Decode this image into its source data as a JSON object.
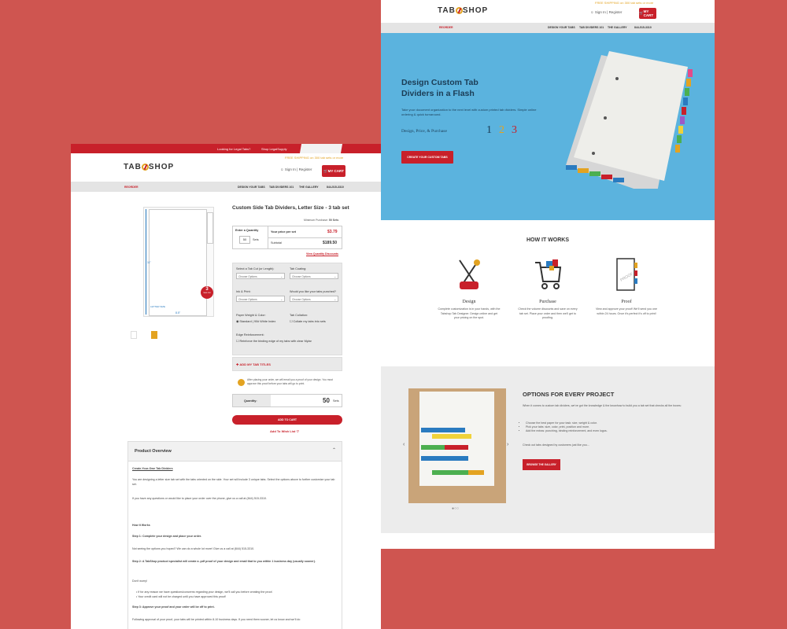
{
  "back": {
    "shipping_text": "FREE SHIPPING on 300 tab sets or more",
    "logo": "TAB SHOP",
    "sign_in": "Sign In",
    "register": "Register",
    "cart": "MY CART",
    "nav": {
      "reorder": "REORDER",
      "design": "DESIGN YOUR TABS",
      "dividers": "TAB DIVIDERS 101",
      "gallery": "THE GALLERY",
      "phone": "844-515-3310"
    },
    "hero": {
      "title": "Design Custom Tab Dividers in a Flash",
      "desc": "Take your document organization to the next level with custom printed tab dividers. Simple online ordering & quick turnaround.",
      "steps_label": "Design, Price, & Purchase",
      "n1": "1",
      "n2": "2",
      "n3": "3",
      "button": "CREATE YOUR CUSTOM TABS"
    },
    "how": {
      "title": "HOW IT WORKS",
      "steps": [
        {
          "title": "Design",
          "desc": "Complete customization is in your hands, with the Tabshop Tab Designer. Design online and get your pricing on the spot."
        },
        {
          "title": "Purchase",
          "desc": "Check the volume discounts and save on every tab set. Place your order and then we'll get to proofing."
        },
        {
          "title": "Proof",
          "desc": "View and approve your proof! We'll send you one within 24 hours. Once it's perfect it's off to print!"
        }
      ],
      "proof_word": "PROOF"
    },
    "options": {
      "title": "OPTIONS FOR EVERY PROJECT",
      "intro": "When it comes to custom tab dividers, we've got the knowledge & the knowhow to build you a tab set that checks all the boxes:",
      "bullets": [
        "Choose the best paper for your task: size, weight & color.",
        "Pick your tabs: size, color, print, position and more.",
        "Add the extras: punching, binding reinforcement, and even logos."
      ],
      "outro": "Check out tabs designed by customers just like you...",
      "button": "BROWSE THE GALLERY"
    }
  },
  "front": {
    "banner": {
      "looking": "Looking for Legal Tabs?",
      "shop": "Shop LegalSupply"
    },
    "shipping_text": "FREE SHIPPING on 300 tab sets or more",
    "logo": "TAB SHOP",
    "sign_in": "Sign In",
    "register": "Register",
    "cart": "MY CART",
    "nav": {
      "reorder": "REORDER",
      "design": "DESIGN YOUR TABS",
      "dividers": "TAB DIVIDERS 101",
      "gallery": "THE GALLERY",
      "phone": "844-515-3310"
    },
    "product": {
      "title": "Custom Side Tab Dividers, Letter Size - 3 tab set",
      "letter_size": "LETTER SIZE",
      "dim_w": "8.5\"",
      "dim_h": "11\"",
      "badge_num": "3",
      "badge_txt": "TABS PER",
      "min_label": "Minimum Purchase:",
      "min_value": "50 Sets",
      "enter_qty": "Enter a Quantity",
      "qty": "50",
      "sets": "Sets",
      "price_label": "Your price per set",
      "price": "$3.79",
      "subtotal_label": "Subtotal",
      "subtotal": "$189.50",
      "discounts": "View Quantity Discounts"
    },
    "options": {
      "tab_cut": "Select a Tab Cut (or Length):",
      "tab_coating": "Tab Coating:",
      "ink": "Ink & Print:",
      "punched": "Would you like your tabs punched?",
      "choose": "Choose Options",
      "paper_label": "Paper Weight & Color:",
      "paper_value": "Standard | 90# White Index",
      "collation_label": "Tab Collation:",
      "collation_value": "Collate my tabs into sets",
      "edge_label": "Edge Reinforcement:",
      "edge_value": "Reinforce the binding edge of my tabs with clear Mylar"
    },
    "add_titles": "ADD MY TAB TITLES",
    "proof_note": "After placing your order, we will email you a proof of your design. You must approve this proof before your tabs will go to print.",
    "quantity_label": "Quantity:",
    "quantity": "50",
    "sets": "Sets",
    "add_to_cart": "ADD TO CART",
    "wish": "Add To Wish List",
    "overview": {
      "heading": "Product Overview",
      "sub": "Create-Your-Own Tab Dividers",
      "p1": "You are designing a letter size tab set with the tabs oriented on the side. Your set will include 3 unique tabs. Select the options above to further customize your tab set.",
      "p2": "If you have any questions or would like to place your order over the phone, give us a call at (844) 515-3310.",
      "how": "How It Works",
      "s1": "Step 1: Complete your design and place your order.",
      "s1b": "Not seeing the options you hoped? We can do a whole lot more! Give us a call at (844) 515-3310.",
      "s2": "Step 2: A TabShop product specialist will create a .pdf proof of your design and email that to you within 1 business day (usually sooner).",
      "dont": "Don't worry!",
      "b1": "If for any reason we have questions/concerns regarding your design, we'll call you before creating the proof.",
      "b2": "Your credit card will not be charged until you have approved this proof!",
      "s3": "Step 3: Approve your proof and your order will be off to print.",
      "s3b": "Following approval of your proof, your tabs will be printed within 8-10 business days. If you need them sooner, let us know and we'll do"
    }
  }
}
